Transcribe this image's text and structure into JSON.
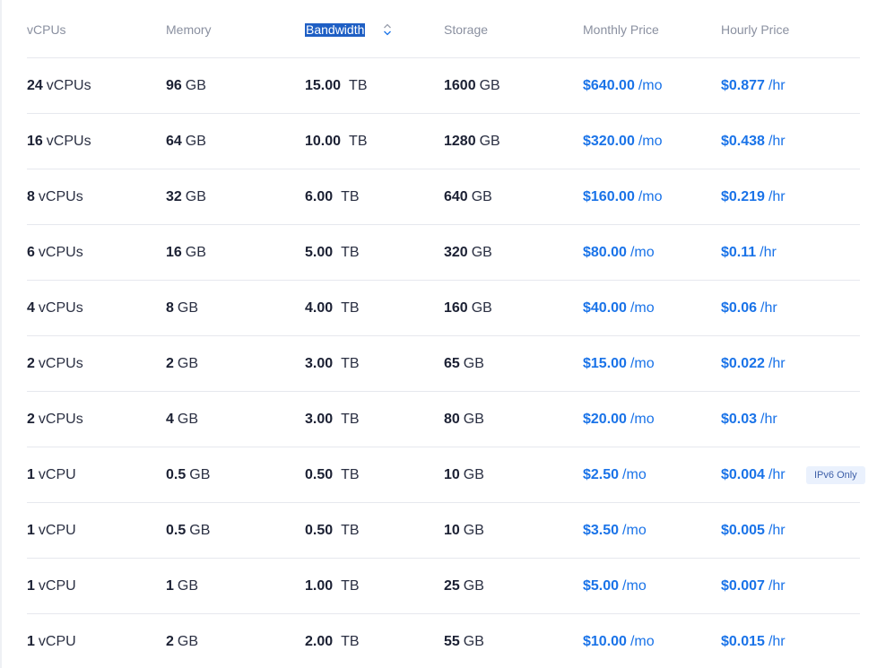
{
  "headers": {
    "vcpus": "vCPUs",
    "memory": "Memory",
    "bandwidth": "Bandwidth",
    "storage": "Storage",
    "monthly_price": "Monthly Price",
    "hourly_price": "Hourly Price"
  },
  "sort_icon": "sort-updown-icon",
  "colors": {
    "price": "#1a73e8",
    "selection": "#1f5fc4",
    "header_text": "#8a90a0",
    "badge_bg": "#eaf1fd"
  },
  "rows": [
    {
      "vcpu_num": "24",
      "vcpu_unit": "vCPUs",
      "mem_num": "96",
      "mem_unit": "GB",
      "bw_num": "15.00",
      "bw_unit": "TB",
      "storage_num": "1600",
      "storage_unit": "GB",
      "monthly": "$640.00",
      "monthly_suffix": "/mo",
      "hourly": "$0.877",
      "hourly_suffix": "/hr",
      "badge": ""
    },
    {
      "vcpu_num": "16",
      "vcpu_unit": "vCPUs",
      "mem_num": "64",
      "mem_unit": "GB",
      "bw_num": "10.00",
      "bw_unit": "TB",
      "storage_num": "1280",
      "storage_unit": "GB",
      "monthly": "$320.00",
      "monthly_suffix": "/mo",
      "hourly": "$0.438",
      "hourly_suffix": "/hr",
      "badge": ""
    },
    {
      "vcpu_num": "8",
      "vcpu_unit": "vCPUs",
      "mem_num": "32",
      "mem_unit": "GB",
      "bw_num": "6.00",
      "bw_unit": "TB",
      "storage_num": "640",
      "storage_unit": "GB",
      "monthly": "$160.00",
      "monthly_suffix": "/mo",
      "hourly": "$0.219",
      "hourly_suffix": "/hr",
      "badge": ""
    },
    {
      "vcpu_num": "6",
      "vcpu_unit": "vCPUs",
      "mem_num": "16",
      "mem_unit": "GB",
      "bw_num": "5.00",
      "bw_unit": "TB",
      "storage_num": "320",
      "storage_unit": "GB",
      "monthly": "$80.00",
      "monthly_suffix": "/mo",
      "hourly": "$0.11",
      "hourly_suffix": "/hr",
      "badge": ""
    },
    {
      "vcpu_num": "4",
      "vcpu_unit": "vCPUs",
      "mem_num": "8",
      "mem_unit": "GB",
      "bw_num": "4.00",
      "bw_unit": "TB",
      "storage_num": "160",
      "storage_unit": "GB",
      "monthly": "$40.00",
      "monthly_suffix": "/mo",
      "hourly": "$0.06",
      "hourly_suffix": "/hr",
      "badge": ""
    },
    {
      "vcpu_num": "2",
      "vcpu_unit": "vCPUs",
      "mem_num": "2",
      "mem_unit": "GB",
      "bw_num": "3.00",
      "bw_unit": "TB",
      "storage_num": "65",
      "storage_unit": "GB",
      "monthly": "$15.00",
      "monthly_suffix": "/mo",
      "hourly": "$0.022",
      "hourly_suffix": "/hr",
      "badge": ""
    },
    {
      "vcpu_num": "2",
      "vcpu_unit": "vCPUs",
      "mem_num": "4",
      "mem_unit": "GB",
      "bw_num": "3.00",
      "bw_unit": "TB",
      "storage_num": "80",
      "storage_unit": "GB",
      "monthly": "$20.00",
      "monthly_suffix": "/mo",
      "hourly": "$0.03",
      "hourly_suffix": "/hr",
      "badge": ""
    },
    {
      "vcpu_num": "1",
      "vcpu_unit": "vCPU",
      "mem_num": "0.5",
      "mem_unit": "GB",
      "bw_num": "0.50",
      "bw_unit": "TB",
      "storage_num": "10",
      "storage_unit": "GB",
      "monthly": "$2.50",
      "monthly_suffix": "/mo",
      "hourly": "$0.004",
      "hourly_suffix": "/hr",
      "badge": "IPv6 Only"
    },
    {
      "vcpu_num": "1",
      "vcpu_unit": "vCPU",
      "mem_num": "0.5",
      "mem_unit": "GB",
      "bw_num": "0.50",
      "bw_unit": "TB",
      "storage_num": "10",
      "storage_unit": "GB",
      "monthly": "$3.50",
      "monthly_suffix": "/mo",
      "hourly": "$0.005",
      "hourly_suffix": "/hr",
      "badge": ""
    },
    {
      "vcpu_num": "1",
      "vcpu_unit": "vCPU",
      "mem_num": "1",
      "mem_unit": "GB",
      "bw_num": "1.00",
      "bw_unit": "TB",
      "storage_num": "25",
      "storage_unit": "GB",
      "monthly": "$5.00",
      "monthly_suffix": "/mo",
      "hourly": "$0.007",
      "hourly_suffix": "/hr",
      "badge": ""
    },
    {
      "vcpu_num": "1",
      "vcpu_unit": "vCPU",
      "mem_num": "2",
      "mem_unit": "GB",
      "bw_num": "2.00",
      "bw_unit": "TB",
      "storage_num": "55",
      "storage_unit": "GB",
      "monthly": "$10.00",
      "monthly_suffix": "/mo",
      "hourly": "$0.015",
      "hourly_suffix": "/hr",
      "badge": ""
    }
  ]
}
